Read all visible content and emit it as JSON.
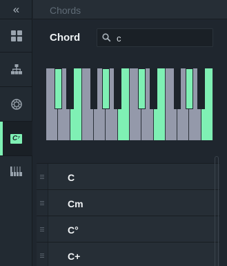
{
  "header": {
    "title": "Chords"
  },
  "sidebar": {
    "collapse_glyph": "«",
    "items": [
      {
        "name": "grid-icon"
      },
      {
        "name": "hierarchy-icon"
      },
      {
        "name": "circle-of-fifths-icon"
      },
      {
        "name": "chord-icon",
        "badge": "C⁷",
        "active": true
      },
      {
        "name": "piano-icon"
      }
    ]
  },
  "chord_field": {
    "label": "Chord",
    "value": "c",
    "placeholder": ""
  },
  "keyboard": {
    "white_keys": 14,
    "highlighted_notes": [
      "C#",
      "E",
      "G#",
      "B"
    ],
    "highlight_color": "#7ff0b4"
  },
  "chords": [
    {
      "label": "C"
    },
    {
      "label": "Cm"
    },
    {
      "label": "C°"
    },
    {
      "label": "C+"
    }
  ],
  "colors": {
    "accent": "#7ff0b4",
    "background": "#1f262e",
    "key_white": "#9499aa",
    "key_black": "#1d242b"
  }
}
